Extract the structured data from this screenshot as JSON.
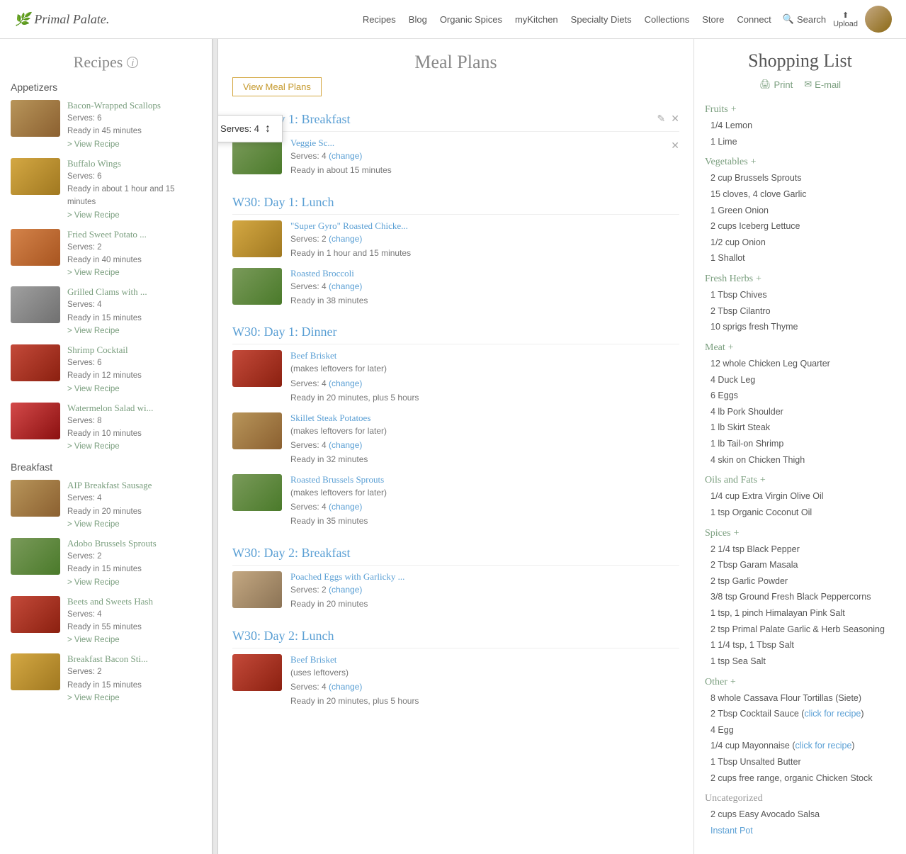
{
  "site": {
    "logo": "Primal Palate.",
    "logo_icon": "🌿"
  },
  "nav": {
    "links": [
      "Recipes",
      "Blog",
      "Organic Spices",
      "myKitchen",
      "Specialty Diets",
      "Collections",
      "Store",
      "Connect"
    ],
    "search_label": "Search",
    "upload_label": "Upload"
  },
  "left_sidebar": {
    "title": "Recipes",
    "info_icon": "i",
    "categories": [
      {
        "label": "Appetizers",
        "recipes": [
          {
            "title": "Bacon-Wrapped Scallops",
            "serves": "Serves: 6",
            "ready": "Ready in 45 minutes",
            "thumb_class": "thumb-brown"
          },
          {
            "title": "Buffalo Wings",
            "serves": "Serves: 6",
            "ready": "Ready in about 1 hour and 15 minutes",
            "thumb_class": "thumb-gold"
          },
          {
            "title": "Fried Sweet Potato ...",
            "serves": "Serves: 2",
            "ready": "Ready in 40 minutes",
            "thumb_class": "thumb-orange"
          },
          {
            "title": "Grilled Clams with ...",
            "serves": "Serves: 4",
            "ready": "Ready in 15 minutes",
            "thumb_class": "thumb-gray"
          },
          {
            "title": "Shrimp Cocktail",
            "serves": "Serves: 6",
            "ready": "Ready in 12 minutes",
            "thumb_class": "thumb-red"
          },
          {
            "title": "Watermelon Salad wi...",
            "serves": "Serves: 8",
            "ready": "Ready in 10 minutes",
            "thumb_class": "thumb-red"
          }
        ]
      },
      {
        "label": "Breakfast",
        "recipes": [
          {
            "title": "AIP Breakfast Sausage",
            "serves": "Serves: 4",
            "ready": "Ready in 20 minutes",
            "thumb_class": "thumb-brown"
          },
          {
            "title": "Adobo Brussels Sprouts",
            "serves": "Serves: 2",
            "ready": "Ready in 15 minutes",
            "thumb_class": "thumb-green"
          },
          {
            "title": "Beets and Sweets Hash",
            "serves": "Serves: 4",
            "ready": "Ready in 55 minutes",
            "thumb_class": "thumb-red"
          },
          {
            "title": "Breakfast Bacon Sti...",
            "serves": "Serves: 2",
            "ready": "Ready in 15 minutes",
            "thumb_class": "thumb-gold"
          }
        ]
      }
    ],
    "view_recipe": "> View Recipe"
  },
  "meal_plans": {
    "title": "Meal Plans",
    "view_btn": "View Meal Plans",
    "tooltip": {
      "text": "Serves: 4",
      "arrow": "↑",
      "cursor": "↕"
    },
    "days": [
      {
        "title": "W30: Day 1: Breakfast",
        "meals": [
          {
            "title": "Veggie Sc...",
            "serves": "4",
            "ready": "about 15 minutes",
            "thumb_class": "thumb-green",
            "has_tooltip": true
          }
        ]
      },
      {
        "title": "W30: Day 1: Lunch",
        "meals": [
          {
            "title": "\"Super Gyro\" Roasted Chicke...",
            "serves": "2",
            "ready": "1 hour and 15 minutes",
            "thumb_class": "thumb-gold"
          },
          {
            "title": "Roasted Broccoli",
            "serves": "4",
            "ready": "38 minutes",
            "thumb_class": "thumb-green"
          }
        ]
      },
      {
        "title": "W30: Day 1: Dinner",
        "meals": [
          {
            "title": "Beef Brisket",
            "note": "(makes leftovers for later)",
            "serves": "4",
            "ready": "20 minutes, plus 5 hours",
            "thumb_class": "thumb-red"
          },
          {
            "title": "Skillet Steak Potatoes",
            "note": "(makes leftovers for later)",
            "serves": "4",
            "ready": "32 minutes",
            "thumb_class": "thumb-brown"
          },
          {
            "title": "Roasted Brussels Sprouts",
            "note": "(makes leftovers for later)",
            "serves": "4",
            "ready": "35 minutes",
            "thumb_class": "thumb-green"
          }
        ]
      },
      {
        "title": "W30: Day 2: Breakfast",
        "meals": [
          {
            "title": "Poached Eggs with Garlicky ...",
            "serves": "2",
            "ready": "20 minutes",
            "thumb_class": "thumb-tan"
          }
        ]
      },
      {
        "title": "W30: Day 2: Lunch",
        "meals": [
          {
            "title": "Beef Brisket",
            "note": "(uses leftovers)",
            "serves": "4",
            "ready": "20 minutes, plus 5 hours",
            "thumb_class": "thumb-red"
          }
        ]
      }
    ]
  },
  "shopping_list": {
    "title": "Shopping List",
    "actions": [
      {
        "label": "Print",
        "icon": "🖨"
      },
      {
        "label": "E-mail",
        "icon": "✉"
      }
    ],
    "categories": [
      {
        "name": "Fruits",
        "items": [
          "1/4 Lemon",
          "1 Lime"
        ]
      },
      {
        "name": "Vegetables",
        "items": [
          "2 cup Brussels Sprouts",
          "15 cloves, 4 clove Garlic",
          "1 Green Onion",
          "2 cups Iceberg Lettuce",
          "1/2 cup Onion",
          "1 Shallot"
        ]
      },
      {
        "name": "Fresh Herbs",
        "items": [
          "1 Tbsp Chives",
          "2 Tbsp Cilantro",
          "10 sprigs fresh Thyme"
        ]
      },
      {
        "name": "Meat",
        "items": [
          "12 whole Chicken Leg Quarter",
          "4 Duck Leg",
          "6 Eggs",
          "4 lb Pork Shoulder",
          "1 lb Skirt Steak",
          "1 lb Tail-on Shrimp",
          "4 skin on Chicken Thigh"
        ]
      },
      {
        "name": "Oils and Fats",
        "items": [
          "1/4 cup Extra Virgin Olive Oil",
          "1 tsp Organic Coconut Oil"
        ]
      },
      {
        "name": "Spices",
        "items": [
          "2 1/4 tsp Black Pepper",
          "2 Tbsp Garam Masala",
          "2 tsp Garlic Powder",
          "3/8 tsp Ground Fresh Black Peppercorns",
          "1 tsp, 1 pinch Himalayan Pink Salt",
          "2 tsp Primal Palate Garlic & Herb Seasoning",
          "1 1/4 tsp, 1 Tbsp Salt",
          "1 tsp Sea Salt"
        ]
      },
      {
        "name": "Other",
        "items": [
          "8 whole Cassava Flour Tortillas (Siete)",
          "2 Tbsp Cocktail Sauce (click for recipe)",
          "4 Egg",
          "1/4 cup Mayonnaise (click for recipe)",
          "1 Tbsp Unsalted Butter",
          "2 cups free range, organic Chicken Stock"
        ]
      },
      {
        "name": "Uncategorized",
        "items": [
          "2 cups Easy Avocado Salsa",
          "Instant Pot"
        ]
      }
    ]
  }
}
